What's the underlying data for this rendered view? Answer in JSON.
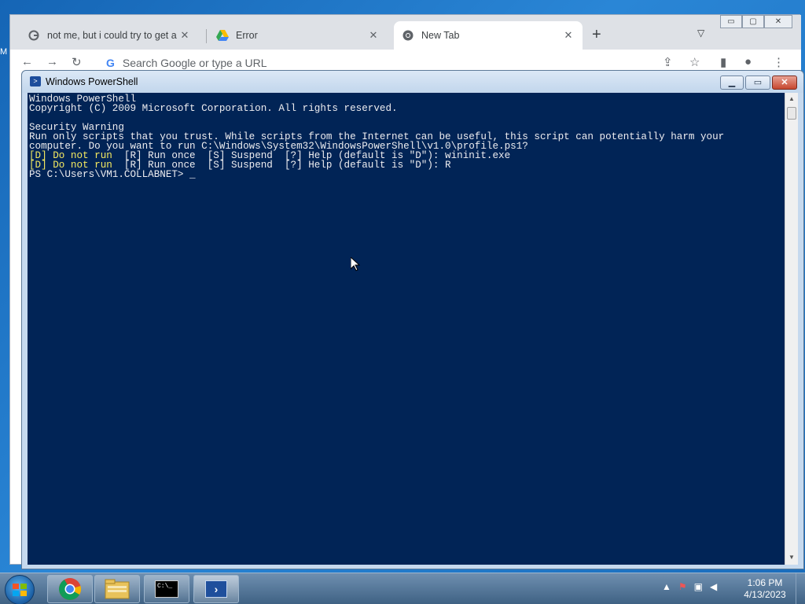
{
  "desktop": {
    "edge_letter": "M"
  },
  "chrome": {
    "tabs": [
      {
        "title": "not me, but i could try to get a w",
        "icon": "google-icon"
      },
      {
        "title": "Error",
        "icon": "google-drive-icon"
      },
      {
        "title": "New Tab",
        "icon": "chrome-icon",
        "active": true
      }
    ],
    "omnibox_placeholder": "Search Google or type a URL",
    "window_controls": {
      "minimize": "▭",
      "maximize": "▢",
      "close": "✕"
    }
  },
  "powershell": {
    "title": "Windows PowerShell",
    "lines": [
      {
        "text": "Windows PowerShell",
        "style": "normal"
      },
      {
        "text": "Copyright (C) 2009 Microsoft Corporation. All rights reserved.",
        "style": "normal"
      },
      {
        "text": "",
        "style": "normal"
      },
      {
        "text": "Security Warning",
        "style": "normal"
      },
      {
        "text": "Run only scripts that you trust. While scripts from the Internet can be useful, this script can potentially harm your",
        "style": "normal"
      },
      {
        "text": "computer. Do you want to run C:\\Windows\\System32\\WindowsPowerShell\\v1.0\\profile.ps1?",
        "style": "normal"
      },
      {
        "yellow": "[D] Do not run",
        "rest": "  [R] Run once  [S] Suspend  [?] Help (default is \"D\"): wininit.exe"
      },
      {
        "yellow": "[D] Do not run",
        "rest": "  [R] Run once  [S] Suspend  [?] Help (default is \"D\"): R"
      },
      {
        "text": "PS C:\\Users\\VM1.COLLABNET> _",
        "style": "normal"
      }
    ]
  },
  "taskbar": {
    "items": [
      "chrome",
      "file-explorer",
      "command-prompt",
      "powershell"
    ],
    "cmd_label": "C:\\_",
    "clock_time": "1:06 PM",
    "clock_date": "4/13/2023"
  }
}
